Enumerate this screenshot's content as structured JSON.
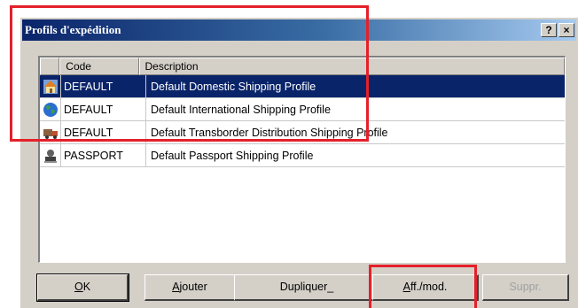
{
  "window": {
    "title": "Profils d'expédition",
    "help_label": "?",
    "close_label": "×"
  },
  "list": {
    "columns": {
      "icon": "",
      "code": "Code",
      "description": "Description"
    },
    "rows": [
      {
        "icon": "house-icon",
        "code": "DEFAULT",
        "description": "Default Domestic Shipping Profile",
        "selected": true
      },
      {
        "icon": "globe-icon",
        "code": "DEFAULT",
        "description": "Default International Shipping Profile",
        "selected": false
      },
      {
        "icon": "truck-icon",
        "code": "DEFAULT",
        "description": "Default Transborder Distribution Shipping Profile",
        "selected": false
      },
      {
        "icon": "passport-icon",
        "code": "PASSPORT",
        "description": "Default Passport Shipping Profile",
        "selected": false
      }
    ]
  },
  "buttons": {
    "ok_u": "O",
    "ok_rest": "K",
    "add_u": "A",
    "add_rest": "jouter",
    "dup_main": "Dupliquer",
    "dup_u": "_",
    "edit_u": "A",
    "edit_rest": "ff./mod.",
    "delete": "Suppr."
  },
  "colors": {
    "selection": "#0a246a",
    "highlight": "#e4202a",
    "dialog_bg": "#d4d0c8"
  }
}
